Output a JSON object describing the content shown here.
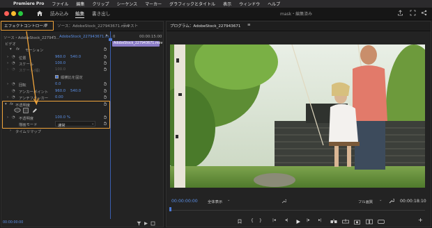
{
  "menubar": {
    "app_name": "Premiere Pro",
    "items": [
      "ファイル",
      "編集",
      "クリップ",
      "シーケンス",
      "マーカー",
      "グラフィックとタイトル",
      "表示",
      "ウィンドウ",
      "ヘルプ"
    ]
  },
  "appbar": {
    "workspace_tabs": [
      "読み込み",
      "編集",
      "書き出し"
    ],
    "active_tab": "編集",
    "document_title": "mask・編集済み"
  },
  "effect_controls": {
    "tabs": [
      "エフェクトコントロール",
      "ソース：AdobeStock_227943671.mov",
      "テキスト"
    ],
    "menu_glyph": "≡",
    "source_label": "ソース・AdobeStock_227943…",
    "clip_label": "AdobeStock_227943671.m…",
    "timecode_start": "0",
    "timecode_end": "00:00:15:00",
    "clip_bar_label": "AdobeStock_227943671.mov",
    "section_video": "ビデオ",
    "motion": {
      "label": "モーション",
      "position_label": "位置",
      "position_x": "960.0",
      "position_y": "540.0",
      "scale_label": "スケール",
      "scale_value": "100.0",
      "scale_width_label": "スケール(幅)",
      "scale_width_value": "100.0",
      "uniform_scale_label": "縦横比を固定",
      "rotation_label": "回転",
      "rotation_value": "0.0",
      "anchor_label": "アンカーポイント",
      "anchor_x": "960.0",
      "anchor_y": "540.0",
      "flicker_label": "アンチフリッカー",
      "flicker_value": "0.00"
    },
    "opacity": {
      "label": "不透明度",
      "opacity_label": "不透明度",
      "opacity_value": "100.0 %",
      "blend_label": "描画モード",
      "blend_value": "通常"
    },
    "time_remap_label": "タイムリマップ",
    "footer_timecode": "00:00:00:00"
  },
  "program_monitor": {
    "title": "プログラム：AdobeStock_227943671",
    "menu_glyph": "≡",
    "timecode": "00:00:00:00",
    "fit_label": "全体表示",
    "quality_label": "フル画質",
    "duration": "00:00:18:10"
  },
  "colors": {
    "highlight": "#f1a53c",
    "timecode_blue": "#5b8fe6",
    "clip_purple": "#8b7cc7"
  }
}
